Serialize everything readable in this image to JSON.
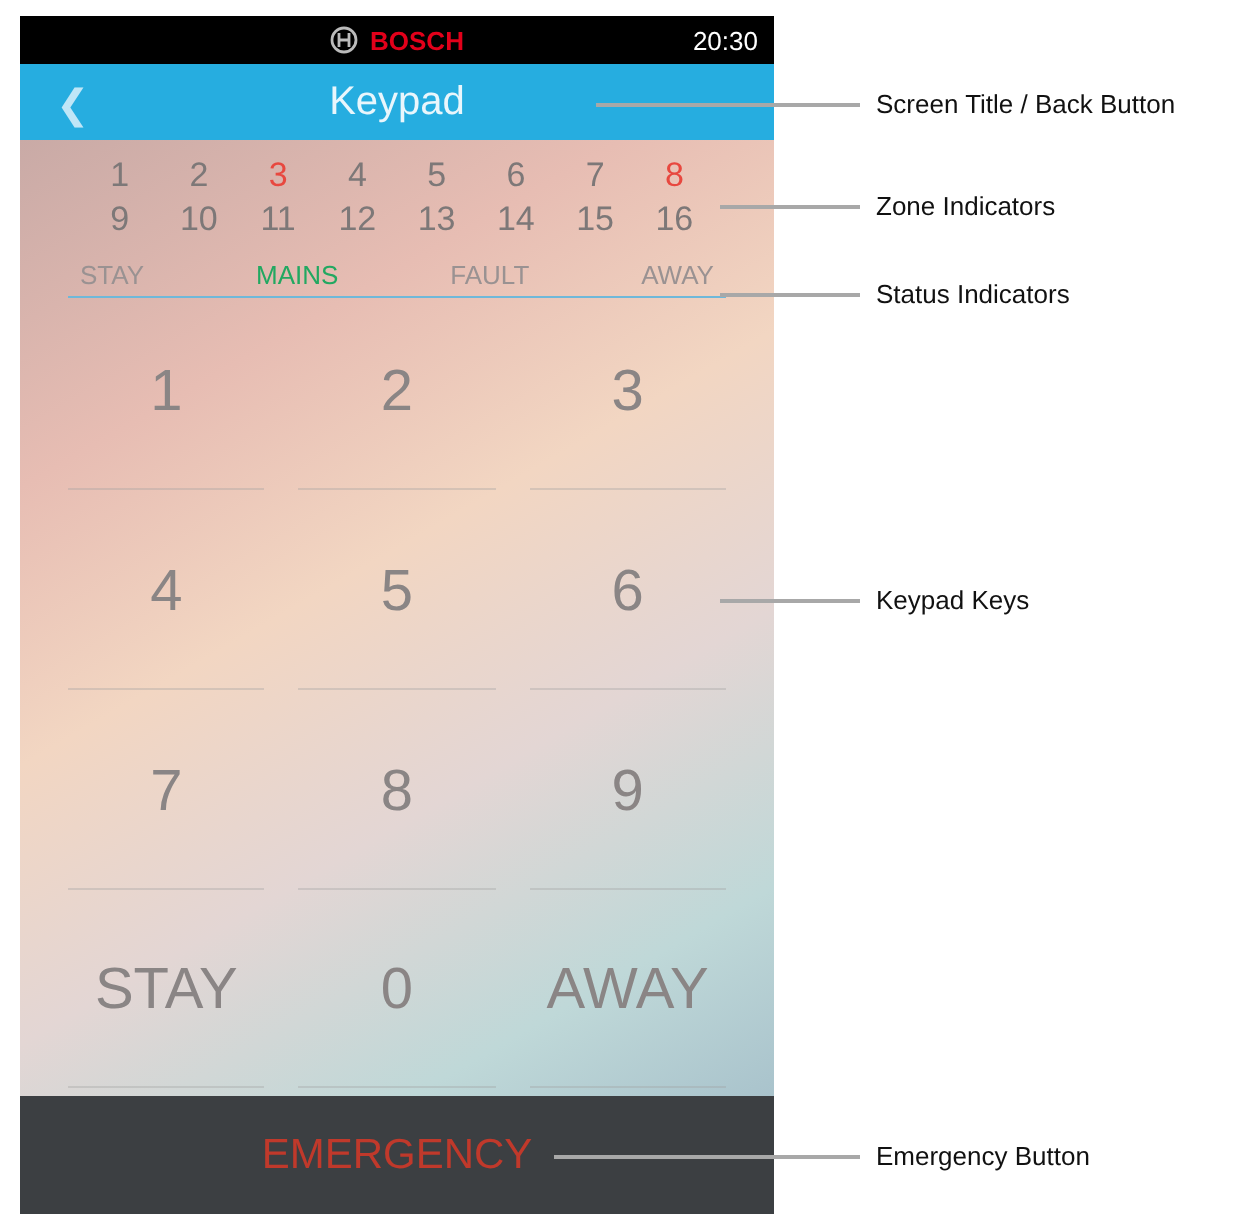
{
  "status_bar": {
    "brand": "BOSCH",
    "time": "20:30"
  },
  "title_bar": {
    "back": "❮",
    "title": "Keypad"
  },
  "zones": [
    {
      "label": "1",
      "alarm": false
    },
    {
      "label": "2",
      "alarm": false
    },
    {
      "label": "3",
      "alarm": true
    },
    {
      "label": "4",
      "alarm": false
    },
    {
      "label": "5",
      "alarm": false
    },
    {
      "label": "6",
      "alarm": false
    },
    {
      "label": "7",
      "alarm": false
    },
    {
      "label": "8",
      "alarm": true
    },
    {
      "label": "9",
      "alarm": false
    },
    {
      "label": "10",
      "alarm": false
    },
    {
      "label": "11",
      "alarm": false
    },
    {
      "label": "12",
      "alarm": false
    },
    {
      "label": "13",
      "alarm": false
    },
    {
      "label": "14",
      "alarm": false
    },
    {
      "label": "15",
      "alarm": false
    },
    {
      "label": "16",
      "alarm": false
    }
  ],
  "status_indicators": [
    {
      "label": "STAY",
      "on": false
    },
    {
      "label": "MAINS",
      "on": true
    },
    {
      "label": "FAULT",
      "on": false
    },
    {
      "label": "AWAY",
      "on": false
    }
  ],
  "keys": [
    {
      "label": "1"
    },
    {
      "label": "2"
    },
    {
      "label": "3"
    },
    {
      "label": "4"
    },
    {
      "label": "5"
    },
    {
      "label": "6"
    },
    {
      "label": "7"
    },
    {
      "label": "8"
    },
    {
      "label": "9"
    },
    {
      "label": "STAY"
    },
    {
      "label": "0"
    },
    {
      "label": "AWAY"
    }
  ],
  "emergency_button": "EMERGENCY",
  "callouts": [
    {
      "label": "Screen Title / Back Button"
    },
    {
      "label": "Zone Indicators"
    },
    {
      "label": "Status Indicators"
    },
    {
      "label": "Keypad Keys"
    },
    {
      "label": "Emergency Button"
    }
  ]
}
